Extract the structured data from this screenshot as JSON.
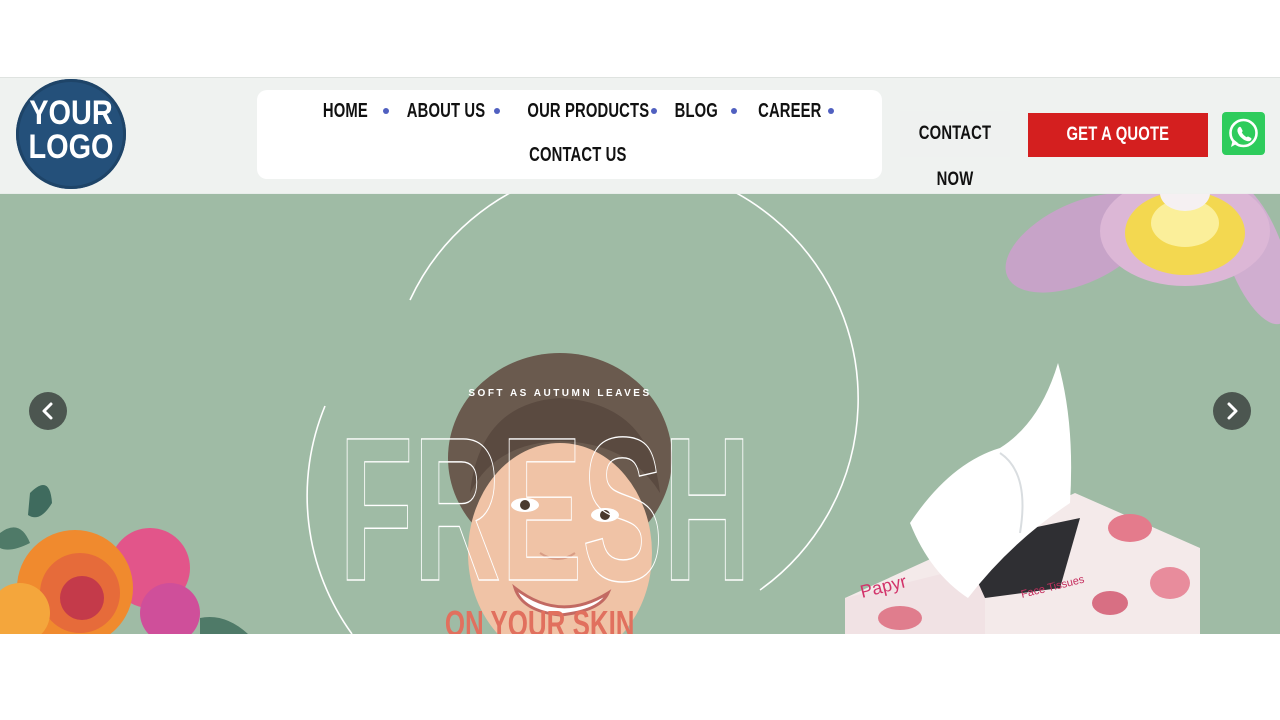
{
  "logo": {
    "line1": "YOUR",
    "line2": "LOGO"
  },
  "nav": {
    "items": [
      {
        "label": "HOME"
      },
      {
        "label": "ABOUT US"
      },
      {
        "label": "OUR PRODUCTS"
      },
      {
        "label": "BLOG"
      },
      {
        "label": "CAREER"
      },
      {
        "label": "CONTACT US"
      }
    ]
  },
  "actions": {
    "contact_now": "CONTACT NOW",
    "get_quote": "GET A QUOTE"
  },
  "hero": {
    "tagline": "SOFT AS AUTUMN LEAVES",
    "headline": "FRESH",
    "subline": "ON YOUR SKIN",
    "product_brand": "Papyr",
    "product_label": "Face Tissues"
  },
  "colors": {
    "hero_bg": "#9fbba5",
    "quote_red": "#d41f1f",
    "whatsapp_green": "#2ecc5c",
    "logo_blue": "#24507a",
    "accent_salmon": "#e1705e"
  },
  "icons": {
    "whatsapp": "whatsapp-icon",
    "prev": "chevron-left-icon",
    "next": "chevron-right-icon"
  }
}
